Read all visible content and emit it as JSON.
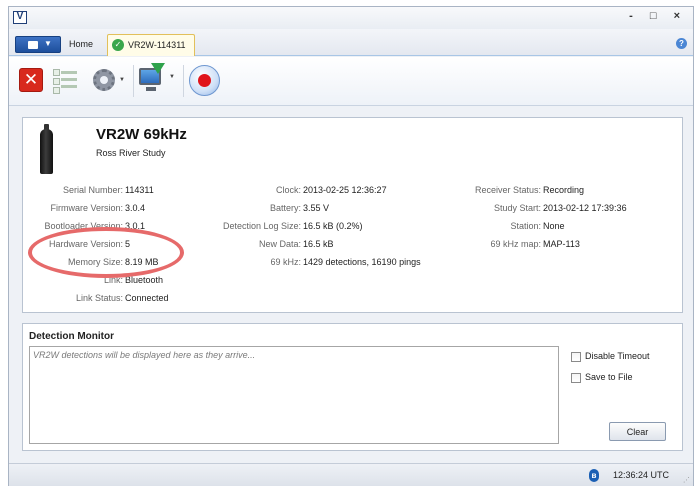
{
  "window": {
    "logo_letter": "V",
    "controls": "- □ ×"
  },
  "tabs": {
    "home": "Home",
    "device": "VR2W-114311"
  },
  "icons": {
    "disconnect": "close-icon",
    "configure": "checklist-icon",
    "settings": "gear-icon",
    "download": "monitor-download-icon",
    "record": "record-icon",
    "help": "help-icon",
    "status_ok": "check-circle-icon",
    "bluetooth": "bluetooth-icon"
  },
  "colors": {
    "accent": "#1e4f9c",
    "record_red": "#e0141b",
    "disconnect_red": "#d8291d",
    "ok_green": "#3aa64b",
    "annotation": "#e66a6a"
  },
  "device": {
    "title": "VR2W 69kHz",
    "subtitle": "Ross River Study"
  },
  "fields": {
    "col1": [
      {
        "label": "Serial Number:",
        "value": "114311"
      },
      {
        "label": "Firmware Version:",
        "value": "3.0.4"
      },
      {
        "label": "Bootloader Version:",
        "value": "3.0.1"
      },
      {
        "label": "Hardware Version:",
        "value": "5"
      },
      {
        "label": "Memory Size:",
        "value": "8.19 MB"
      },
      {
        "label": "Link:",
        "value": "Bluetooth"
      },
      {
        "label": "Link Status:",
        "value": "Connected"
      }
    ],
    "col2": [
      {
        "label": "Clock:",
        "value": "2013-02-25 12:36:27"
      },
      {
        "label": "Battery:",
        "value": "3.55 V"
      },
      {
        "label": "Detection Log Size:",
        "value": "16.5 kB (0.2%)"
      },
      {
        "label": "New Data:",
        "value": "16.5 kB"
      },
      {
        "label": "69 kHz:",
        "value": "1429 detections, 16190 pings"
      }
    ],
    "col3": [
      {
        "label": "Receiver Status:",
        "value": "Recording"
      },
      {
        "label": "Study Start:",
        "value": "2013-02-12 17:39:36"
      },
      {
        "label": "Station:",
        "value": "None"
      },
      {
        "label": "69 kHz map:",
        "value": "MAP-113"
      }
    ]
  },
  "monitor": {
    "title": "Detection Monitor",
    "placeholder": "VR2W detections will be displayed here as they arrive...",
    "disable_timeout": "Disable Timeout",
    "save_to_file": "Save to File",
    "clear": "Clear"
  },
  "status": {
    "time": "12:36:24 UTC"
  }
}
